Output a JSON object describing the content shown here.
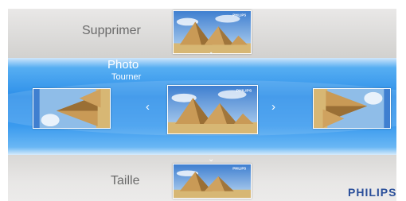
{
  "menu": {
    "prev_item": "Supprimer",
    "current_item": "Photo",
    "current_action": "Tourner",
    "next_item": "Taille"
  },
  "brand": "PHILIPS",
  "thumb_brand": "PHILIPS",
  "icons": {
    "left_arrow": "‹",
    "right_arrow": "›",
    "up_chevron": "⌃",
    "down_chevron": "⌄"
  },
  "colors": {
    "highlight_blue": "#2d8fe9",
    "brand_blue": "#2a4f9a",
    "label_gray": "#6a6a6a"
  }
}
